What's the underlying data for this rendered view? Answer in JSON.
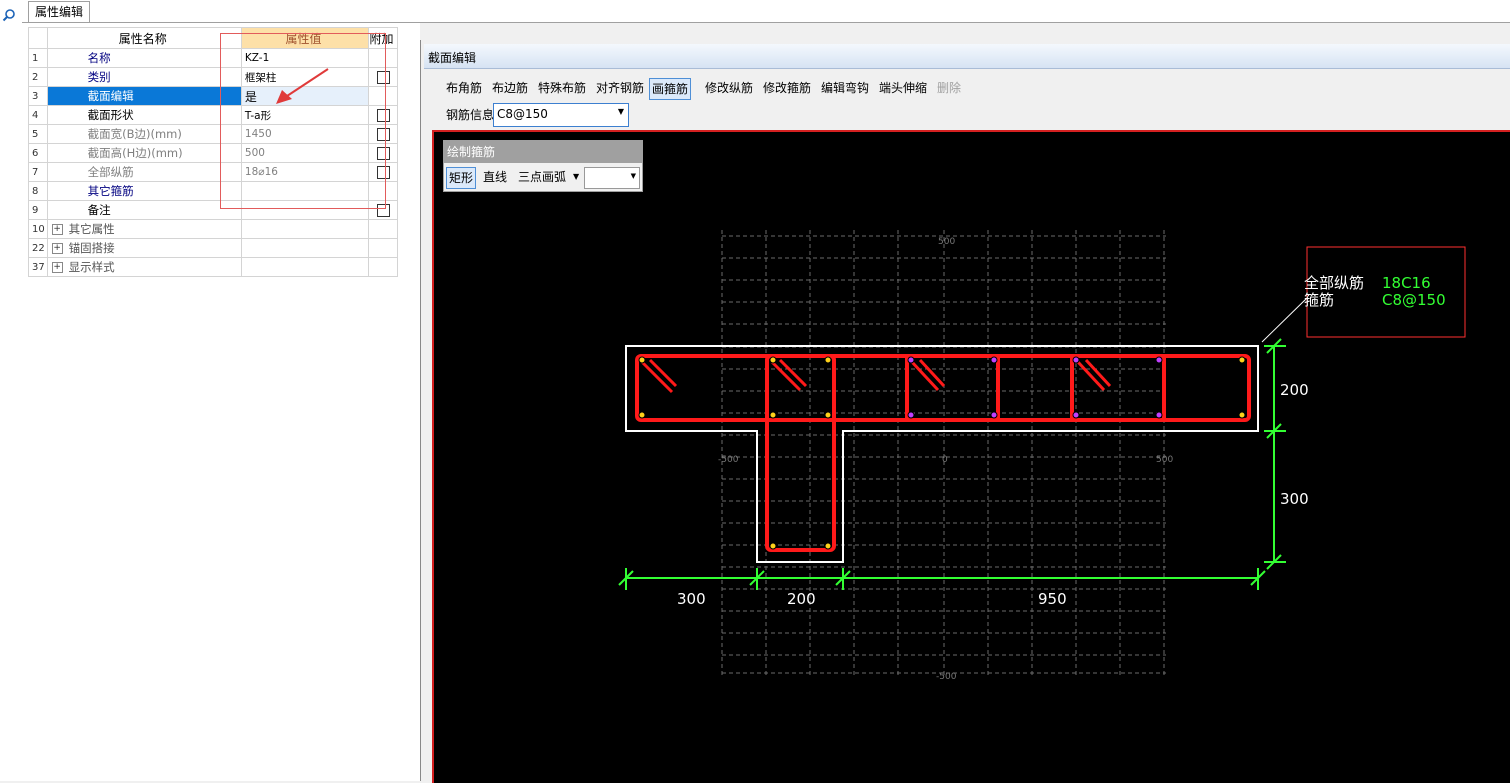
{
  "app": {
    "tab_label": "属性编辑"
  },
  "grid": {
    "headers": {
      "name": "属性名称",
      "value": "属性值",
      "extra": "附加"
    },
    "rows": [
      {
        "num": "1",
        "name": "名称",
        "value": "KZ-1",
        "checkbox": false
      },
      {
        "num": "2",
        "name": "类别",
        "value": "框架柱",
        "checkbox": true
      },
      {
        "num": "3",
        "name": "截面编辑",
        "value": "是",
        "checkbox": false
      },
      {
        "num": "4",
        "name": "截面形状",
        "value": "T-a形",
        "checkbox": true
      },
      {
        "num": "5",
        "name": "截面宽(B边)(mm)",
        "value": "1450",
        "checkbox": true
      },
      {
        "num": "6",
        "name": "截面高(H边)(mm)",
        "value": "500",
        "checkbox": true
      },
      {
        "num": "7",
        "name": "全部纵筋",
        "value": "18⌀16",
        "checkbox": true
      },
      {
        "num": "8",
        "name": "其它箍筋",
        "value": "",
        "checkbox": false
      },
      {
        "num": "9",
        "name": "备注",
        "value": "",
        "checkbox": true
      },
      {
        "num": "10",
        "name": "其它属性",
        "value": "",
        "checkbox": false
      },
      {
        "num": "22",
        "name": "锚固搭接",
        "value": "",
        "checkbox": false
      },
      {
        "num": "37",
        "name": "显示样式",
        "value": "",
        "checkbox": false
      }
    ]
  },
  "editor": {
    "title": "截面编辑",
    "toolbar": [
      "布角筋",
      "布边筋",
      "特殊布筋",
      "对齐钢筋",
      "画箍筋",
      "修改纵筋",
      "修改箍筋",
      "编辑弯钩",
      "端头伸缩",
      "删除"
    ],
    "active_tool": "画箍筋",
    "rebar_info_label": "钢筋信息",
    "rebar_info_value": "C8@150",
    "draw_panel": {
      "title": "绘制箍筋",
      "modes": [
        "矩形",
        "直线",
        "三点画弧"
      ],
      "active_mode": "矩形"
    }
  },
  "canvas": {
    "legend": {
      "longitudinal_label": "全部纵筋",
      "longitudinal_value": "18C16",
      "stirrup_label": "箍筋",
      "stirrup_value": "C8@150"
    },
    "dimensions": {
      "bottom": [
        "300",
        "200",
        "950"
      ],
      "right": [
        "200",
        "300"
      ]
    },
    "grid_labels": {
      "top": "500",
      "left": "-500",
      "center": "0",
      "right": "500",
      "bottom": "-500"
    },
    "colors": {
      "stirrup": "#ff1a1a",
      "outline": "#ffffff",
      "dimension": "#33ff33",
      "legend_box": "#ff3030",
      "background": "#000000"
    }
  }
}
